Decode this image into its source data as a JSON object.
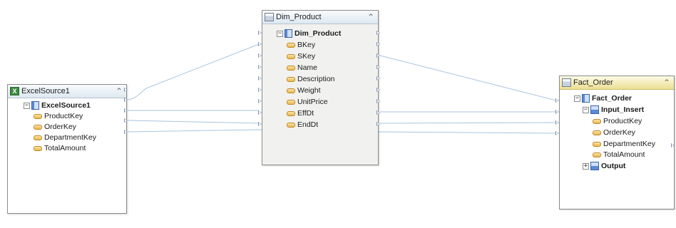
{
  "excel_source": {
    "title": "ExcelSource1",
    "root": "ExcelSource1",
    "columns": [
      "ProductKey",
      "OrderKey",
      "DepartmentKey",
      "TotalAmount"
    ]
  },
  "dim_product": {
    "title": "Dim_Product",
    "root": "Dim_Product",
    "columns": [
      "BKey",
      "SKey",
      "Name",
      "Description",
      "Weight",
      "UnitPrice",
      "EffDt",
      "EndDt"
    ]
  },
  "fact_order": {
    "title": "Fact_Order",
    "root": "Fact_Order",
    "input_group": "Input_Insert",
    "columns": [
      "ProductKey",
      "OrderKey",
      "DepartmentKey",
      "TotalAmount"
    ],
    "output_group": "Output"
  },
  "icons": {
    "collapse": "double-chevron-up-icon",
    "expanded": "minus-box-icon",
    "collapsed": "plus-box-icon",
    "table": "table-icon",
    "column": "column-icon",
    "excel": "excel-icon"
  },
  "colors": {
    "link": "#a9c5de",
    "port": "#7d92ad",
    "header_blue": "#dde8f1",
    "header_yellow": "#ecdf92"
  }
}
